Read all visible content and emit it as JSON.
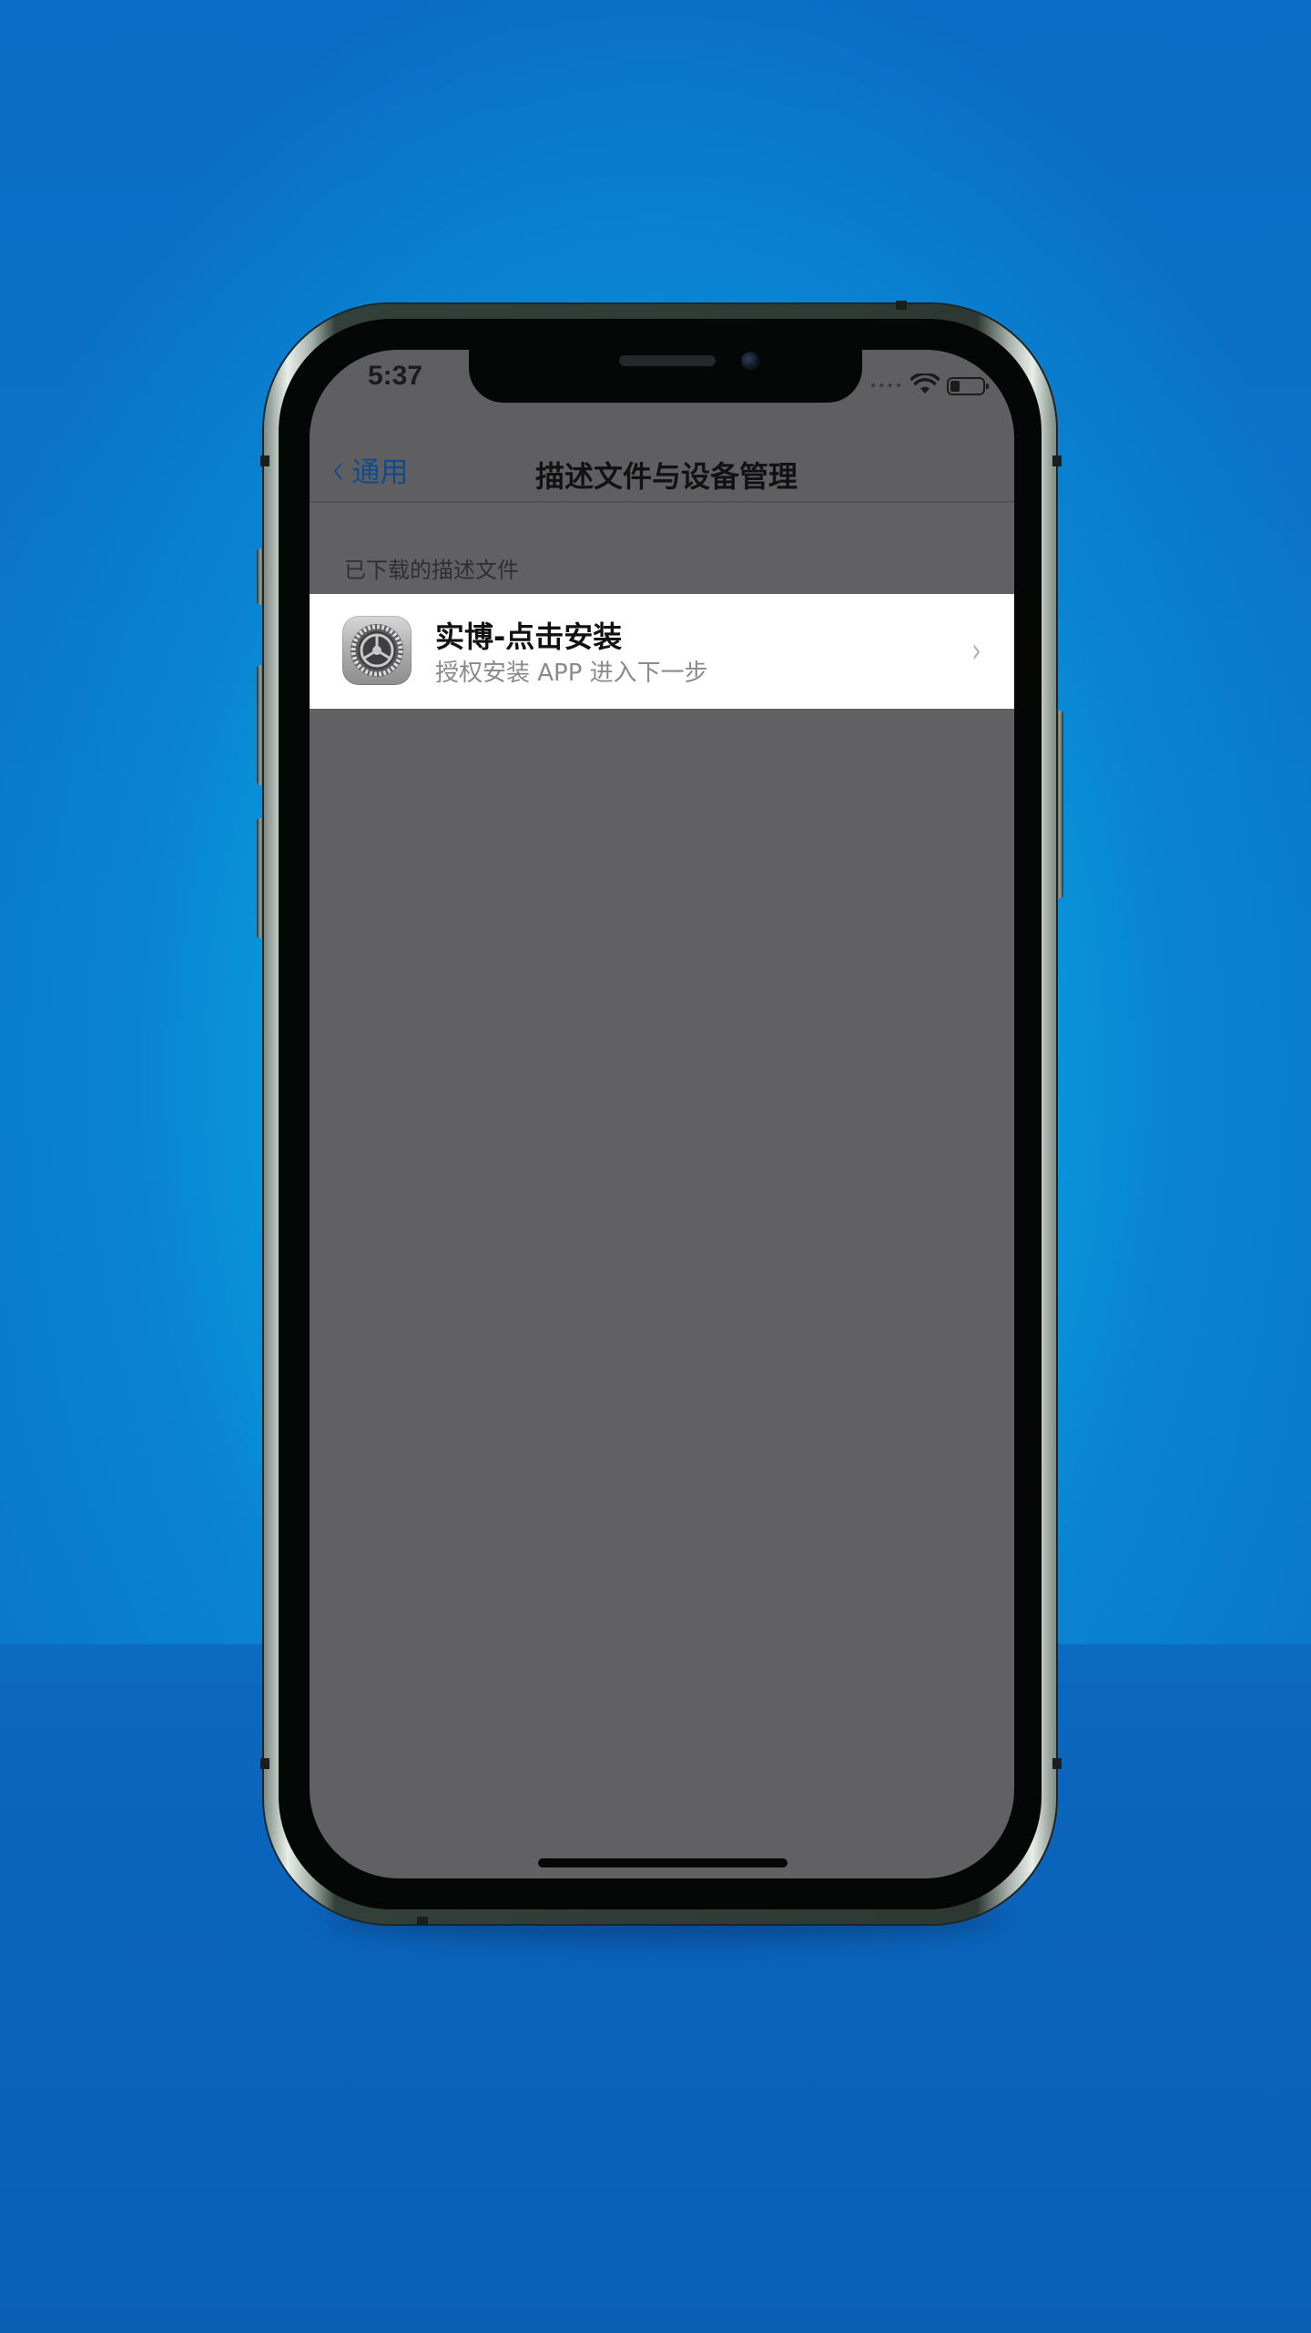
{
  "status_bar": {
    "time": "5:37",
    "signal_dots": "••••",
    "wifi_icon": "wifi-icon",
    "battery_icon": "battery-icon"
  },
  "nav": {
    "back_label": "通用",
    "back_icon": "chevron-left-icon",
    "title": "描述文件与设备管理"
  },
  "section": {
    "header": "已下载的描述文件"
  },
  "profile": {
    "title": "实博-点击安装",
    "subtitle": "授权安装 APP 进入下一步",
    "icon": "settings-gear-icon",
    "disclosure_icon": "chevron-right-icon"
  },
  "colors": {
    "background": "#0b79cb",
    "overlay": "#616163",
    "back_tint": "#0f4c8f",
    "row_bg": "#ffffff"
  }
}
